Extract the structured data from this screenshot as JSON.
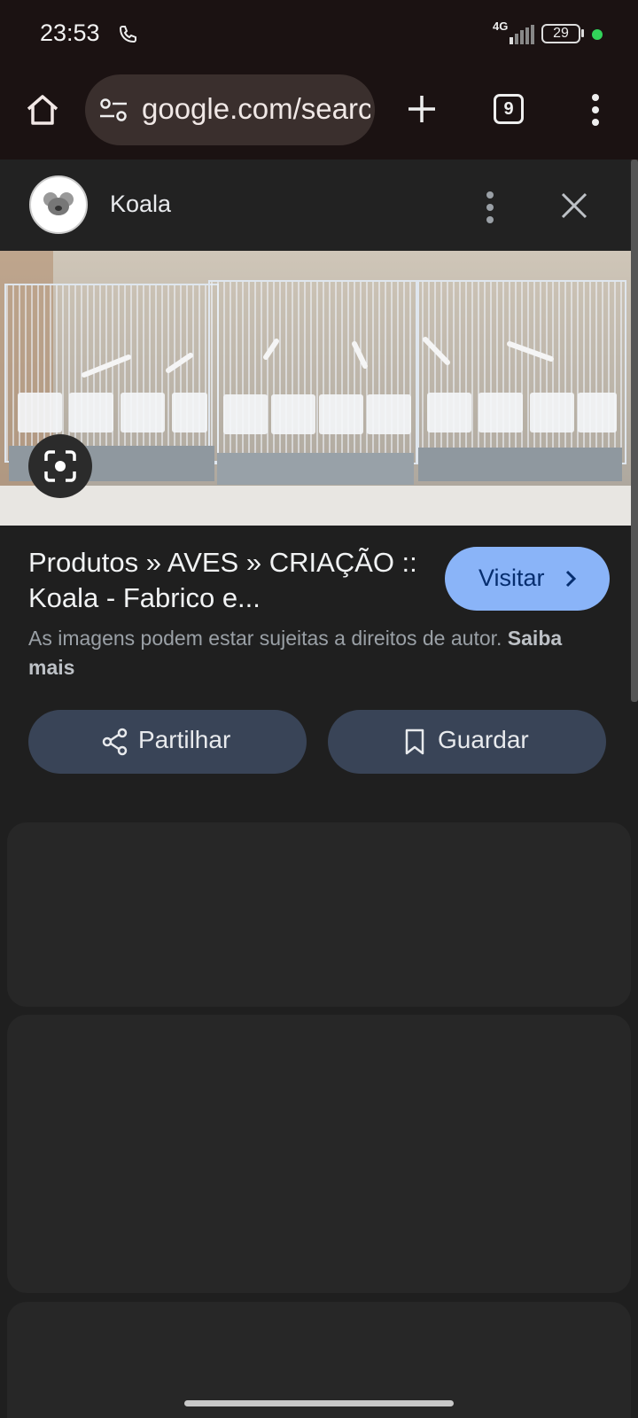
{
  "status_bar": {
    "time": "23:53",
    "network": "4G",
    "battery": "29"
  },
  "toolbar": {
    "url": "google.com/search",
    "tab_count": "9"
  },
  "panel": {
    "site_name": "Koala",
    "title": "Produtos » AVES » CRIAÇÃO :: Koala - Fabrico e...",
    "visit_label": "Visitar",
    "copyright_text": "As imagens podem estar sujeitas a direitos de autor.",
    "learn_more": "Saiba mais",
    "share_label": "Partilhar",
    "save_label": "Guardar"
  },
  "colors": {
    "accent": "#8ab4f8",
    "chip": "#394457",
    "background": "#1f1f1f"
  }
}
